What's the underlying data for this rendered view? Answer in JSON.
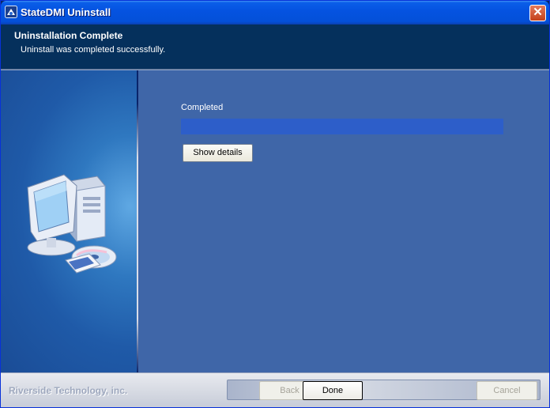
{
  "window": {
    "title": "StateDMI Uninstall",
    "close_glyph": "✕"
  },
  "header": {
    "title": "Uninstallation Complete",
    "subtitle": "Uninstall was completed successfully."
  },
  "content": {
    "status_label": "Completed",
    "progress_fraction": 1.0,
    "show_details_label": "Show details"
  },
  "footer": {
    "brand": "Riverside Technology, inc.",
    "back_label": "Back",
    "done_label": "Done",
    "cancel_label": "Cancel"
  },
  "icons": {
    "app": "installer-icon",
    "close": "close-icon",
    "illustration": "computer-cd-icon"
  },
  "colors": {
    "title_bar": "#0553e1",
    "header_bg": "#05305c",
    "content_bg": "#3f66a8",
    "progress_fill": "#2d5ec9",
    "close_button": "#c4401a"
  }
}
